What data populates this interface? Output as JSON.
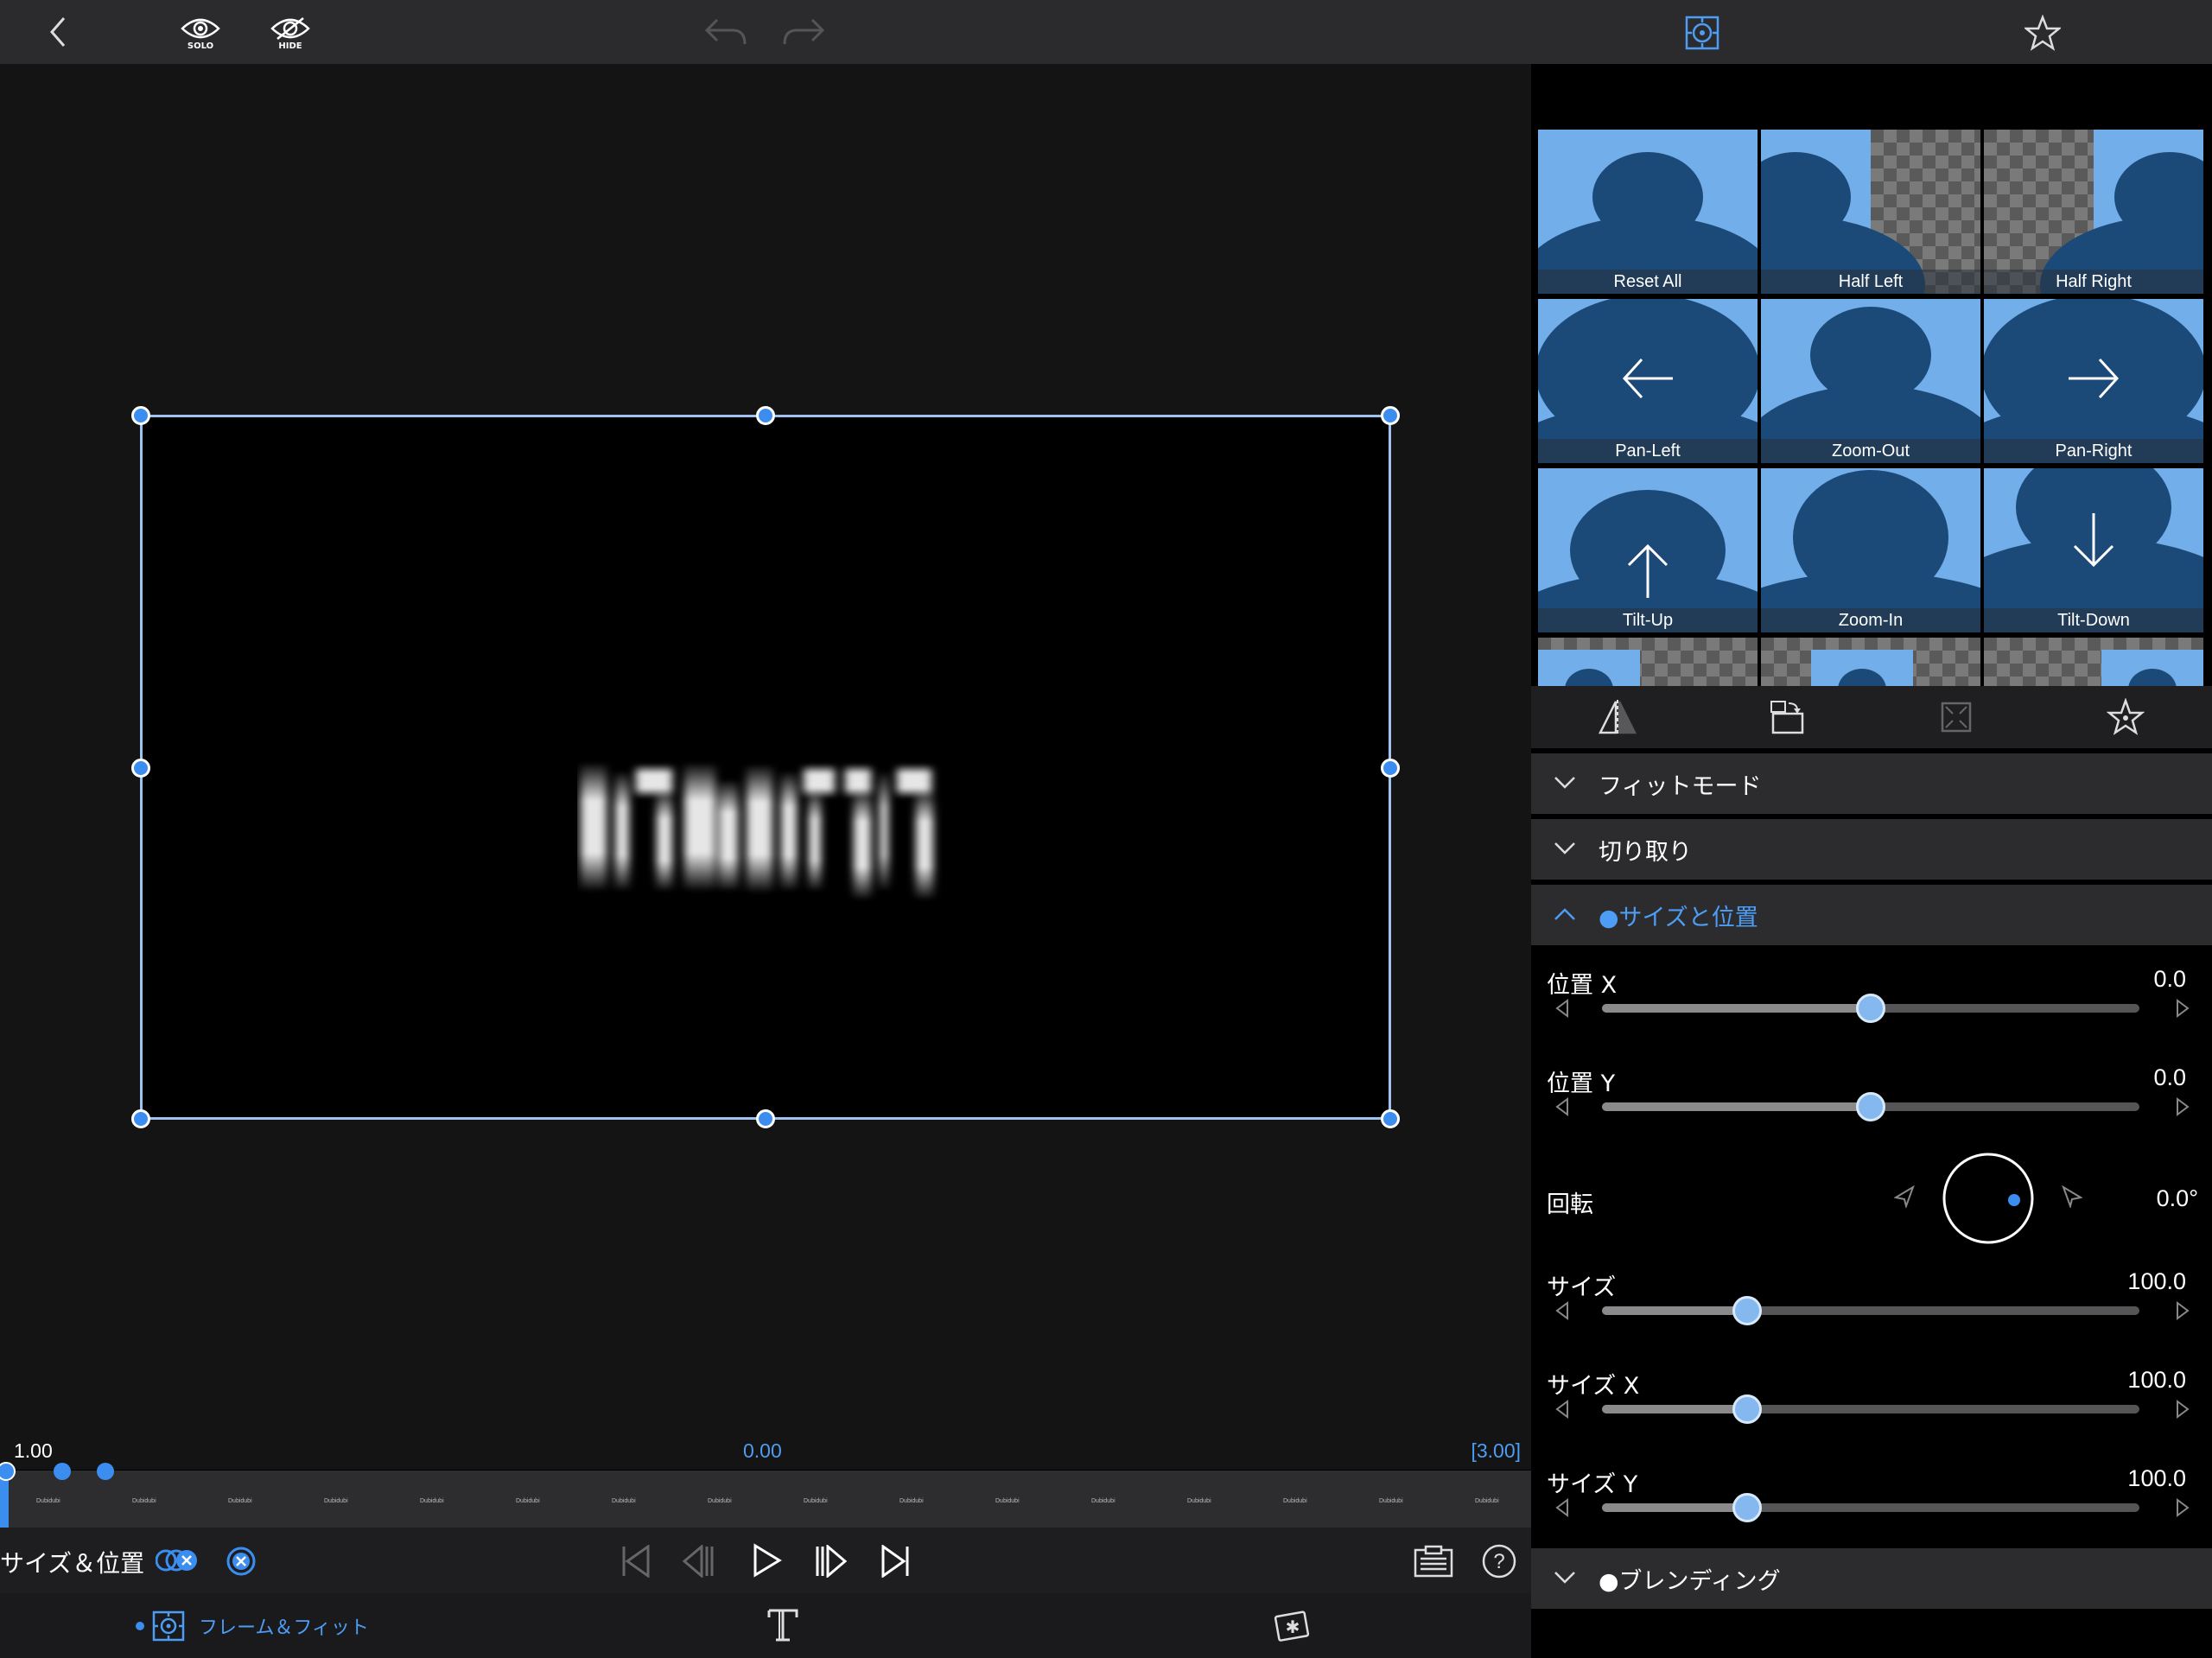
{
  "topbar": {
    "solo_label": "SOLO",
    "hide_label": "HIDE"
  },
  "timeline": {
    "zoom": "1.00",
    "current_time": "0.00",
    "duration": "[3.00]",
    "tick_label": "Dubidubi",
    "tick_count": 16
  },
  "transport": {
    "mode_label": "サイズ＆位置"
  },
  "bottombar": {
    "frame_fit_label": "フレーム＆フィット"
  },
  "presets": [
    {
      "label": "Reset All"
    },
    {
      "label": "Half Left"
    },
    {
      "label": "Half Right"
    },
    {
      "label": "Pan-Left"
    },
    {
      "label": "Zoom-Out"
    },
    {
      "label": "Pan-Right"
    },
    {
      "label": "Tilt-Up"
    },
    {
      "label": "Zoom-In"
    },
    {
      "label": "Tilt-Down"
    }
  ],
  "sections": {
    "fit_mode": "フィットモード",
    "crop": "切り取り",
    "size_position": "●サイズと位置",
    "blending": "●ブレンディング"
  },
  "properties": {
    "pos_x": {
      "label": "位置 X",
      "value": "0.0",
      "fraction": 0.5
    },
    "pos_y": {
      "label": "位置 Y",
      "value": "0.0",
      "fraction": 0.5
    },
    "rotation": {
      "label": "回転",
      "value": "0.0°"
    },
    "size": {
      "label": "サイズ",
      "value": "100.0",
      "fraction": 0.27
    },
    "size_x": {
      "label": "サイズ X",
      "value": "100.0",
      "fraction": 0.27
    },
    "size_y": {
      "label": "サイズ Y",
      "value": "100.0",
      "fraction": 0.27
    }
  },
  "colors": {
    "accent": "#3b8ef0",
    "preset_bg": "#72aeea",
    "silhouette": "#1c4a78"
  }
}
